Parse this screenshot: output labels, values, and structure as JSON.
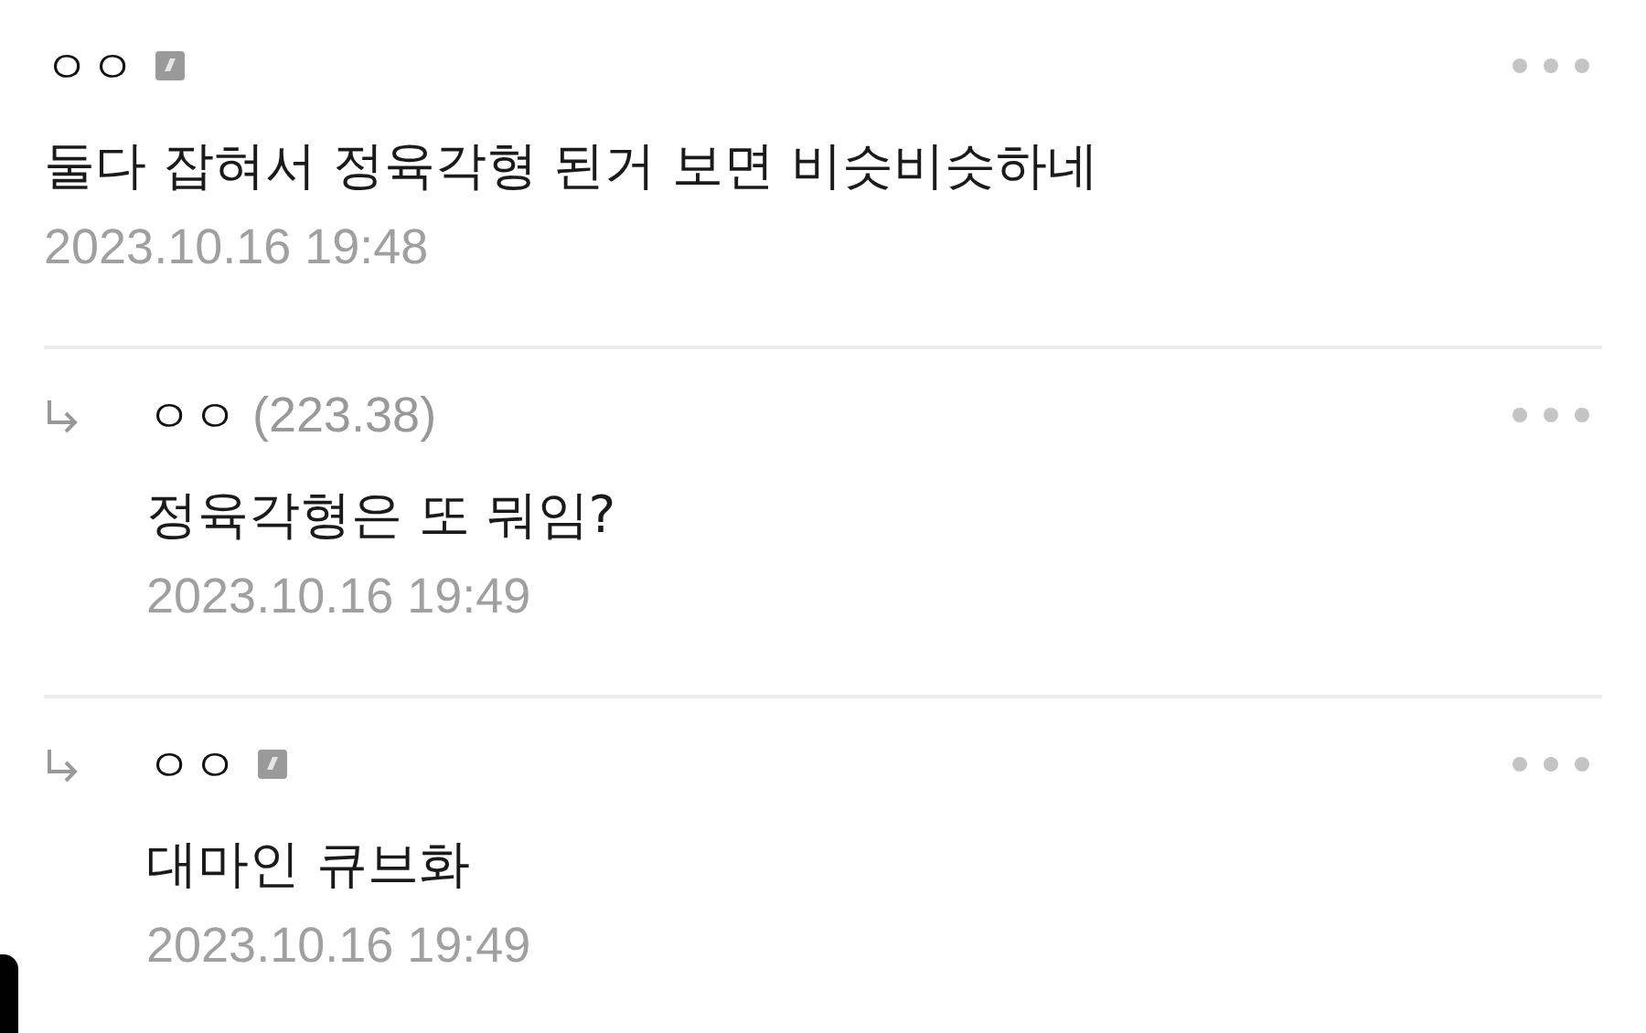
{
  "comments": [
    {
      "kind": "comment",
      "author": "ㅇㅇ",
      "member_badge": true,
      "text": "둘다 잡혀서 정육각형 된거 보면 비슷비슷하네",
      "date": "2023.10.16 19:48"
    },
    {
      "kind": "reply",
      "author": "ㅇㅇ",
      "ip": "(223.38)",
      "member_badge": false,
      "text": "정육각형은 또 뭐임?",
      "date": "2023.10.16 19:49"
    },
    {
      "kind": "reply",
      "author": "ㅇㅇ",
      "member_badge": true,
      "text": "대마인 큐브화",
      "date": "2023.10.16 19:49"
    }
  ]
}
